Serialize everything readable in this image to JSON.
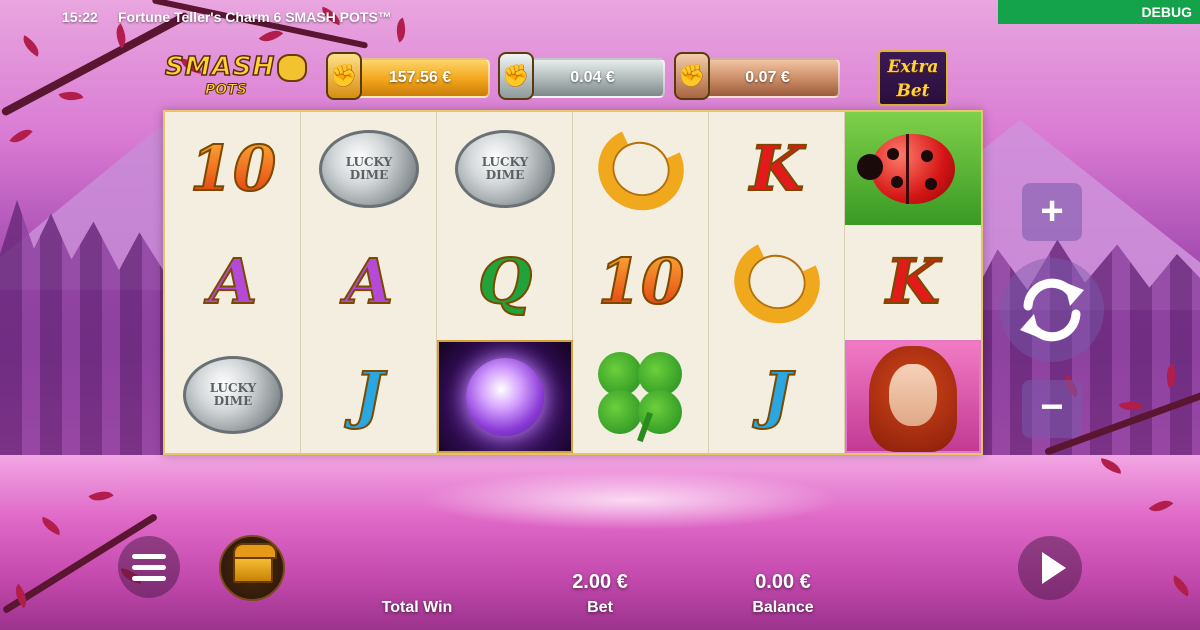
{
  "status_bar": {
    "time": "15:22",
    "title": "Fortune Teller's Charm 6 SMASH POTS™",
    "debug_label": "DEBUG"
  },
  "logo": {
    "word": "SMASH",
    "sub": "POTS"
  },
  "jackpots": {
    "gold": "157.56 €",
    "silver": "0.04 €",
    "bronze": "0.07 €"
  },
  "extra_bet": {
    "line1": "Extra",
    "line2": "Bet"
  },
  "reels": [
    [
      "10",
      "A",
      "coin"
    ],
    [
      "coin",
      "A",
      "J"
    ],
    [
      "coin",
      "Q",
      "crystal-ball"
    ],
    [
      "horseshoe",
      "10",
      "clover"
    ],
    [
      "K",
      "horseshoe",
      "J"
    ],
    [
      "ladybug",
      "K",
      "fortune-teller"
    ]
  ],
  "coin_text": {
    "line1": "LUCKY",
    "line2": "DIME"
  },
  "controls": {
    "plus": "+",
    "minus": "−"
  },
  "bottom": {
    "total_win_label": "Total Win",
    "bet_value": "2.00 €",
    "bet_label": "Bet",
    "balance_value": "0.00 €",
    "balance_label": "Balance"
  },
  "colors": {
    "debug_bg": "#14a34a",
    "reel_bg": "#f3eee0",
    "reel_border": "#e5c46a"
  }
}
